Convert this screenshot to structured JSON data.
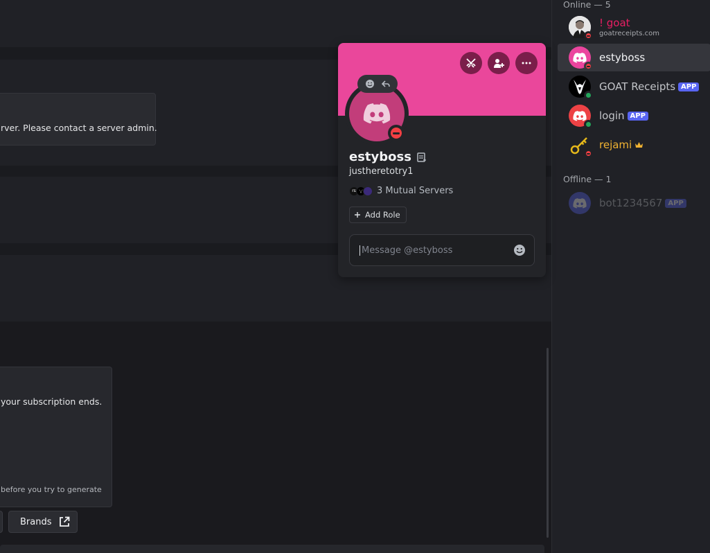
{
  "chat": {
    "error_text": "rver. Please contact a server admin.",
    "sub_text": "your subscription ends.",
    "hint_text": "before you try to generate",
    "brands_label": "Brands"
  },
  "members": {
    "online_header": "Online — 5",
    "offline_header": "Offline — 1",
    "list": [
      {
        "name": "! goat",
        "sub": "goatreceipts.com",
        "status": "dnd",
        "color": "#e91e63"
      },
      {
        "name": "estyboss",
        "status": "dnd",
        "color": "#f2f3f5",
        "active": true
      },
      {
        "name": "GOAT Receipts",
        "tag": "APP",
        "status": "online",
        "color": "#c2c4c8"
      },
      {
        "name": "login",
        "tag": "APP",
        "status": "online",
        "color": "#c2c4c8"
      },
      {
        "name": "rejami",
        "status": "dnd",
        "color": "#f0b232",
        "crown": true
      }
    ],
    "offline": [
      {
        "name": "bot1234567",
        "tag": "APP"
      }
    ]
  },
  "profile": {
    "display_name": "estyboss",
    "username": "justheretotry1",
    "mutual_servers": "3 Mutual Servers",
    "server_badge_1": "rs",
    "add_role": "Add Role",
    "message_placeholder": "Message @estyboss",
    "banner_color": "#ea479b"
  }
}
